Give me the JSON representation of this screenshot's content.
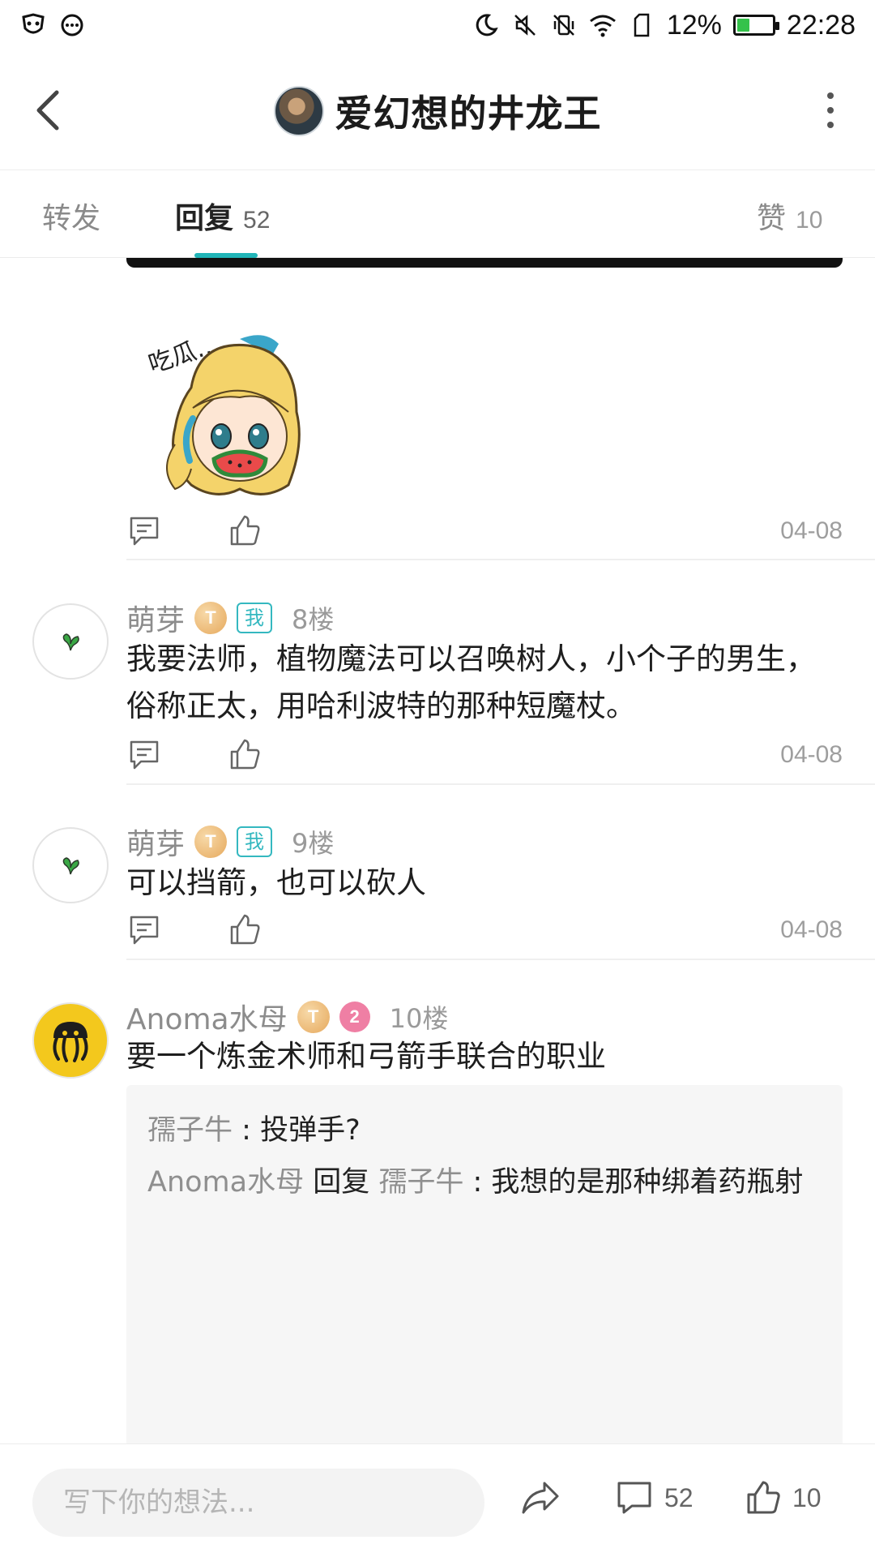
{
  "status_bar": {
    "battery_percent": "12%",
    "battery_level": 0.12,
    "time": "22:28",
    "icons": [
      "app-mask-icon",
      "chat-bubble-icon",
      "moon-icon",
      "mute-icon",
      "vibrate-off-icon",
      "wifi-icon",
      "sim-icon",
      "battery-icon"
    ]
  },
  "header": {
    "title": "爱幻想的井龙王"
  },
  "tabs": [
    {
      "label": "转发",
      "count": ""
    },
    {
      "label": "回复",
      "count": "52"
    },
    {
      "label": "赞",
      "count": "10"
    }
  ],
  "sticker": {
    "text": "吃瓜…"
  },
  "comments": [
    {
      "user": "",
      "floor": "",
      "text": "",
      "date": "04-08"
    },
    {
      "user": "萌芽",
      "level": "T",
      "me_tag": "我",
      "floor": "8楼",
      "text": "我要法师，植物魔法可以召唤树人，小个子的男生，俗称正太，用哈利波特的那种短魔杖。",
      "date": "04-08"
    },
    {
      "user": "萌芽",
      "level": "T",
      "me_tag": "我",
      "floor": "9楼",
      "text": "可以挡箭，也可以砍人",
      "date": "04-08"
    },
    {
      "user": "Anoma水母",
      "level": "T",
      "badge2": "2",
      "floor": "10楼",
      "text": "要一个炼金术师和弓箭手联合的职业",
      "replies": [
        {
          "name": "孺子牛",
          "sep": " : ",
          "text": "投弹手?"
        },
        {
          "name": "Anoma水母",
          "mid": " 回复 ",
          "target": "孺子牛",
          "sep": " : ",
          "text": "我想的是那种绑着药瓶射"
        }
      ]
    }
  ],
  "bottom_bar": {
    "placeholder": "写下你的想法...",
    "comment_count": "52",
    "like_count": "10"
  },
  "colors": {
    "accent": "#21b5b8",
    "me_tag": "#34b8c0",
    "battery": "#35c24b",
    "level_badge": "#e6a95d",
    "pink_badge": "#ef7fa4"
  }
}
